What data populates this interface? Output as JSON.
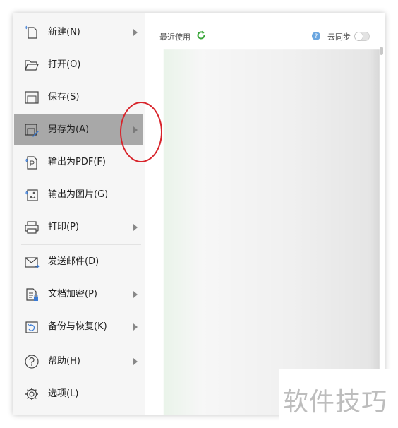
{
  "menu": {
    "items": [
      {
        "label": "新建(N)",
        "icon": "new-file-icon",
        "submenu": true
      },
      {
        "label": "打开(O)",
        "icon": "folder-open-icon",
        "submenu": false
      },
      {
        "label": "保存(S)",
        "icon": "save-icon",
        "submenu": false
      },
      {
        "label": "另存为(A)",
        "icon": "save-as-icon",
        "submenu": true,
        "active": true
      },
      {
        "label": "输出为PDF(F)",
        "icon": "export-pdf-icon",
        "submenu": false
      },
      {
        "label": "输出为图片(G)",
        "icon": "export-image-icon",
        "submenu": false
      },
      {
        "label": "打印(P)",
        "icon": "printer-icon",
        "submenu": true
      },
      {
        "label": "发送邮件(D)",
        "icon": "mail-icon",
        "submenu": false
      },
      {
        "label": "文档加密(P)",
        "icon": "encrypt-document-icon",
        "submenu": true
      },
      {
        "label": "备份与恢复(K)",
        "icon": "backup-restore-icon",
        "submenu": true
      },
      {
        "label": "帮助(H)",
        "icon": "help-circle-icon",
        "submenu": true
      },
      {
        "label": "选项(L)",
        "icon": "gear-icon",
        "submenu": false
      }
    ]
  },
  "recent": {
    "label": "最近使用",
    "cloud_sync_label": "云同步",
    "cloud_sync_on": false
  },
  "watermark": {
    "text": "软件技巧"
  },
  "colors": {
    "active_item": "#a8a8a8",
    "annotation": "#d8232a",
    "refresh": "#3aa63a",
    "help": "#6aa6e0"
  }
}
